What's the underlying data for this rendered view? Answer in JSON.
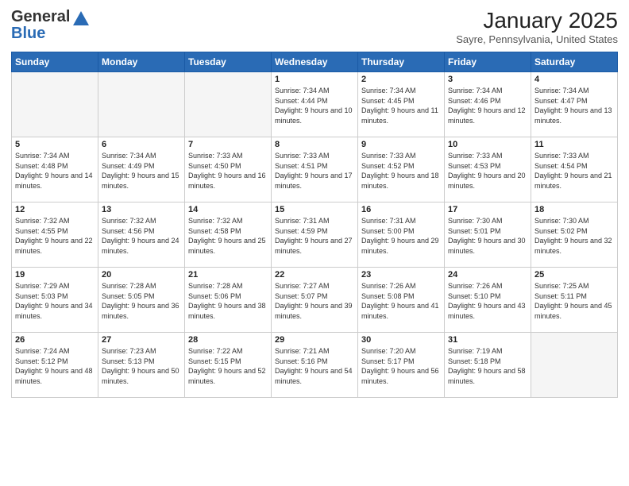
{
  "logo": {
    "line1": "General",
    "line2": "Blue"
  },
  "header": {
    "month": "January 2025",
    "location": "Sayre, Pennsylvania, United States"
  },
  "days_of_week": [
    "Sunday",
    "Monday",
    "Tuesday",
    "Wednesday",
    "Thursday",
    "Friday",
    "Saturday"
  ],
  "weeks": [
    [
      {
        "day": "",
        "sunrise": "",
        "sunset": "",
        "daylight": "",
        "empty": true
      },
      {
        "day": "",
        "sunrise": "",
        "sunset": "",
        "daylight": "",
        "empty": true
      },
      {
        "day": "",
        "sunrise": "",
        "sunset": "",
        "daylight": "",
        "empty": true
      },
      {
        "day": "1",
        "sunrise": "Sunrise: 7:34 AM",
        "sunset": "Sunset: 4:44 PM",
        "daylight": "Daylight: 9 hours and 10 minutes."
      },
      {
        "day": "2",
        "sunrise": "Sunrise: 7:34 AM",
        "sunset": "Sunset: 4:45 PM",
        "daylight": "Daylight: 9 hours and 11 minutes."
      },
      {
        "day": "3",
        "sunrise": "Sunrise: 7:34 AM",
        "sunset": "Sunset: 4:46 PM",
        "daylight": "Daylight: 9 hours and 12 minutes."
      },
      {
        "day": "4",
        "sunrise": "Sunrise: 7:34 AM",
        "sunset": "Sunset: 4:47 PM",
        "daylight": "Daylight: 9 hours and 13 minutes."
      }
    ],
    [
      {
        "day": "5",
        "sunrise": "Sunrise: 7:34 AM",
        "sunset": "Sunset: 4:48 PM",
        "daylight": "Daylight: 9 hours and 14 minutes."
      },
      {
        "day": "6",
        "sunrise": "Sunrise: 7:34 AM",
        "sunset": "Sunset: 4:49 PM",
        "daylight": "Daylight: 9 hours and 15 minutes."
      },
      {
        "day": "7",
        "sunrise": "Sunrise: 7:33 AM",
        "sunset": "Sunset: 4:50 PM",
        "daylight": "Daylight: 9 hours and 16 minutes."
      },
      {
        "day": "8",
        "sunrise": "Sunrise: 7:33 AM",
        "sunset": "Sunset: 4:51 PM",
        "daylight": "Daylight: 9 hours and 17 minutes."
      },
      {
        "day": "9",
        "sunrise": "Sunrise: 7:33 AM",
        "sunset": "Sunset: 4:52 PM",
        "daylight": "Daylight: 9 hours and 18 minutes."
      },
      {
        "day": "10",
        "sunrise": "Sunrise: 7:33 AM",
        "sunset": "Sunset: 4:53 PM",
        "daylight": "Daylight: 9 hours and 20 minutes."
      },
      {
        "day": "11",
        "sunrise": "Sunrise: 7:33 AM",
        "sunset": "Sunset: 4:54 PM",
        "daylight": "Daylight: 9 hours and 21 minutes."
      }
    ],
    [
      {
        "day": "12",
        "sunrise": "Sunrise: 7:32 AM",
        "sunset": "Sunset: 4:55 PM",
        "daylight": "Daylight: 9 hours and 22 minutes."
      },
      {
        "day": "13",
        "sunrise": "Sunrise: 7:32 AM",
        "sunset": "Sunset: 4:56 PM",
        "daylight": "Daylight: 9 hours and 24 minutes."
      },
      {
        "day": "14",
        "sunrise": "Sunrise: 7:32 AM",
        "sunset": "Sunset: 4:58 PM",
        "daylight": "Daylight: 9 hours and 25 minutes."
      },
      {
        "day": "15",
        "sunrise": "Sunrise: 7:31 AM",
        "sunset": "Sunset: 4:59 PM",
        "daylight": "Daylight: 9 hours and 27 minutes."
      },
      {
        "day": "16",
        "sunrise": "Sunrise: 7:31 AM",
        "sunset": "Sunset: 5:00 PM",
        "daylight": "Daylight: 9 hours and 29 minutes."
      },
      {
        "day": "17",
        "sunrise": "Sunrise: 7:30 AM",
        "sunset": "Sunset: 5:01 PM",
        "daylight": "Daylight: 9 hours and 30 minutes."
      },
      {
        "day": "18",
        "sunrise": "Sunrise: 7:30 AM",
        "sunset": "Sunset: 5:02 PM",
        "daylight": "Daylight: 9 hours and 32 minutes."
      }
    ],
    [
      {
        "day": "19",
        "sunrise": "Sunrise: 7:29 AM",
        "sunset": "Sunset: 5:03 PM",
        "daylight": "Daylight: 9 hours and 34 minutes."
      },
      {
        "day": "20",
        "sunrise": "Sunrise: 7:28 AM",
        "sunset": "Sunset: 5:05 PM",
        "daylight": "Daylight: 9 hours and 36 minutes."
      },
      {
        "day": "21",
        "sunrise": "Sunrise: 7:28 AM",
        "sunset": "Sunset: 5:06 PM",
        "daylight": "Daylight: 9 hours and 38 minutes."
      },
      {
        "day": "22",
        "sunrise": "Sunrise: 7:27 AM",
        "sunset": "Sunset: 5:07 PM",
        "daylight": "Daylight: 9 hours and 39 minutes."
      },
      {
        "day": "23",
        "sunrise": "Sunrise: 7:26 AM",
        "sunset": "Sunset: 5:08 PM",
        "daylight": "Daylight: 9 hours and 41 minutes."
      },
      {
        "day": "24",
        "sunrise": "Sunrise: 7:26 AM",
        "sunset": "Sunset: 5:10 PM",
        "daylight": "Daylight: 9 hours and 43 minutes."
      },
      {
        "day": "25",
        "sunrise": "Sunrise: 7:25 AM",
        "sunset": "Sunset: 5:11 PM",
        "daylight": "Daylight: 9 hours and 45 minutes."
      }
    ],
    [
      {
        "day": "26",
        "sunrise": "Sunrise: 7:24 AM",
        "sunset": "Sunset: 5:12 PM",
        "daylight": "Daylight: 9 hours and 48 minutes."
      },
      {
        "day": "27",
        "sunrise": "Sunrise: 7:23 AM",
        "sunset": "Sunset: 5:13 PM",
        "daylight": "Daylight: 9 hours and 50 minutes."
      },
      {
        "day": "28",
        "sunrise": "Sunrise: 7:22 AM",
        "sunset": "Sunset: 5:15 PM",
        "daylight": "Daylight: 9 hours and 52 minutes."
      },
      {
        "day": "29",
        "sunrise": "Sunrise: 7:21 AM",
        "sunset": "Sunset: 5:16 PM",
        "daylight": "Daylight: 9 hours and 54 minutes."
      },
      {
        "day": "30",
        "sunrise": "Sunrise: 7:20 AM",
        "sunset": "Sunset: 5:17 PM",
        "daylight": "Daylight: 9 hours and 56 minutes."
      },
      {
        "day": "31",
        "sunrise": "Sunrise: 7:19 AM",
        "sunset": "Sunset: 5:18 PM",
        "daylight": "Daylight: 9 hours and 58 minutes."
      },
      {
        "day": "",
        "sunrise": "",
        "sunset": "",
        "daylight": "",
        "empty": true
      }
    ]
  ]
}
